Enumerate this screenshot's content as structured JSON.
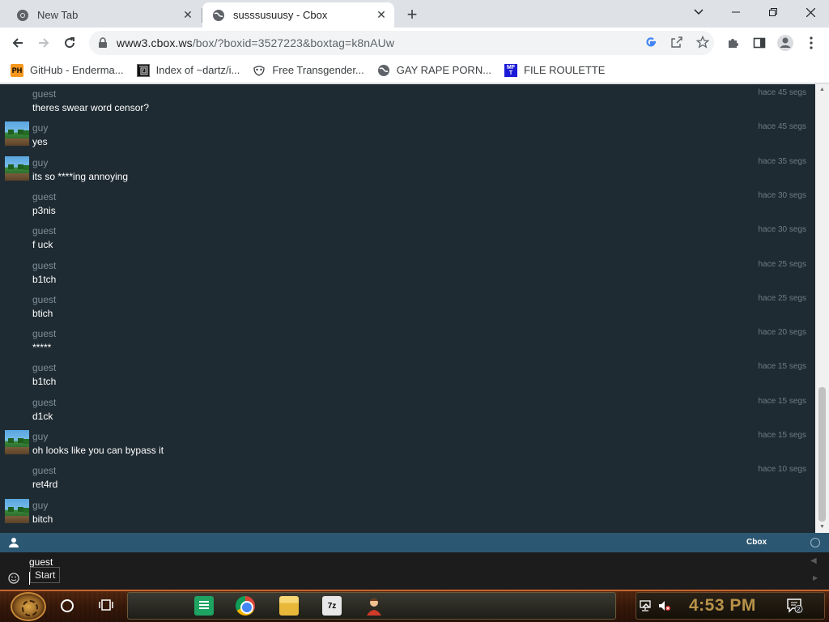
{
  "browser": {
    "tabs": [
      {
        "title": "New Tab",
        "active": false
      },
      {
        "title": "susssusuusy - Cbox",
        "active": true
      }
    ],
    "url_host": "www3.cbox.ws",
    "url_path": "/box/?boxid=3527223&boxtag=k8nAUw",
    "bookmarks": [
      {
        "label": "GitHub - Enderma...",
        "icon": "ph-icon"
      },
      {
        "label": "Index of ~dartz/i...",
        "icon": "maze-icon"
      },
      {
        "label": "Free Transgender...",
        "icon": "mask-icon"
      },
      {
        "label": "GAY RAPE PORN...",
        "icon": "globe-icon"
      },
      {
        "label": "FILE ROULETTE",
        "icon": "mft-icon"
      }
    ]
  },
  "chat": {
    "messages": [
      {
        "user": "guest",
        "text": "theres swear word censor?",
        "time": "hace 45 segs",
        "avatar": false
      },
      {
        "user": "guy",
        "text": "yes",
        "time": "hace 45 segs",
        "avatar": true
      },
      {
        "user": "guy",
        "text": "its so ****ing annoying",
        "time": "hace 35 segs",
        "avatar": true
      },
      {
        "user": "guest",
        "text": "p3nis",
        "time": "hace 30 segs",
        "avatar": false
      },
      {
        "user": "guest",
        "text": "f uck",
        "time": "hace 30 segs",
        "avatar": false
      },
      {
        "user": "guest",
        "text": "b1tch",
        "time": "hace 25 segs",
        "avatar": false
      },
      {
        "user": "guest",
        "text": "btich",
        "time": "hace 25 segs",
        "avatar": false
      },
      {
        "user": "guest",
        "text": "*****",
        "time": "hace 20 segs",
        "avatar": false
      },
      {
        "user": "guest",
        "text": "b1tch",
        "time": "hace 15 segs",
        "avatar": false
      },
      {
        "user": "guest",
        "text": "d1ck",
        "time": "hace 15 segs",
        "avatar": false
      },
      {
        "user": "guy",
        "text": "oh looks like you can bypass it",
        "time": "hace 15 segs",
        "avatar": true
      },
      {
        "user": "guest",
        "text": "ret4rd",
        "time": "hace 10 segs",
        "avatar": false
      },
      {
        "user": "guy",
        "text": "bitch",
        "time": "",
        "avatar": true
      }
    ],
    "brand": "Cbox",
    "input": {
      "name": "guest",
      "value": ""
    },
    "tooltip": "Start"
  },
  "taskbar": {
    "clock": "4:53 PM",
    "notification_count": "2",
    "apps": [
      "google-sheets-icon",
      "chrome-icon",
      "file-explorer-icon",
      "7zip-icon",
      "user-app-icon"
    ],
    "seven_zip_label": "7z"
  },
  "colors": {
    "chat_bg": "#1f2b33",
    "cbox_bar": "#2c5773",
    "clock": "#b8934a"
  }
}
